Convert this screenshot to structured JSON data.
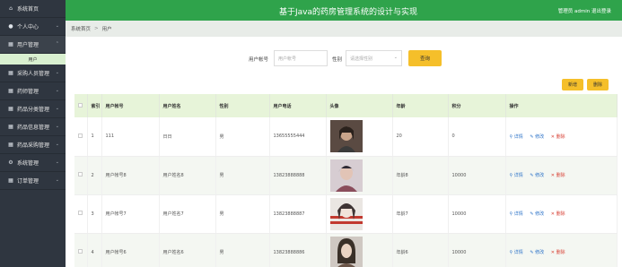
{
  "header": {
    "title": "基于Java的药房管理系统的设计与实现",
    "user_info": "管理员 admin",
    "logout": "退出登录"
  },
  "sidebar": {
    "items": [
      {
        "label": "系统首页",
        "icon": "home-icon"
      },
      {
        "label": "个人中心",
        "icon": "user-icon"
      },
      {
        "label": "用户管理",
        "icon": "grid-icon"
      },
      {
        "label": "采购人员管理",
        "icon": "grid-icon"
      },
      {
        "label": "药师管理",
        "icon": "grid-icon"
      },
      {
        "label": "药品分类管理",
        "icon": "grid-icon"
      },
      {
        "label": "药品信息管理",
        "icon": "grid-icon"
      },
      {
        "label": "药品采购管理",
        "icon": "grid-icon"
      },
      {
        "label": "系统管理",
        "icon": "gear-icon"
      },
      {
        "label": "订单管理",
        "icon": "grid-icon"
      }
    ],
    "sub_item": "用户"
  },
  "breadcrumb": {
    "home": "系统首页",
    "separator": ">",
    "current": "用户"
  },
  "search": {
    "account_label": "用户帐号",
    "account_placeholder": "用户帐号",
    "gender_label": "性别",
    "gender_placeholder": "请选择性别",
    "button": "查询"
  },
  "actions": {
    "add": "新增",
    "delete": "删除"
  },
  "table": {
    "headers": [
      "",
      "索引",
      "用户帐号",
      "用户姓名",
      "性别",
      "用户电话",
      "头像",
      "年龄",
      "积分",
      "操作"
    ],
    "rows": [
      {
        "index": "1",
        "account": "111",
        "name": "日日",
        "gender": "男",
        "phone": "13655555444",
        "age": "20",
        "points": "0",
        "photo_colors": [
          "#5a4a42",
          "#c9a48a",
          "#3b3b3b"
        ]
      },
      {
        "index": "2",
        "account": "用户帐号8",
        "name": "用户姓名8",
        "gender": "男",
        "phone": "13823888888",
        "age": "年龄8",
        "points": "10000",
        "photo_colors": [
          "#2e2a34",
          "#e2c4b6",
          "#8a4d5c"
        ]
      },
      {
        "index": "3",
        "account": "用户帐号7",
        "name": "用户姓名7",
        "gender": "男",
        "phone": "13823888887",
        "age": "年龄7",
        "points": "10000",
        "photo_colors": [
          "#c2392f",
          "#f1e3da",
          "#3e3434"
        ]
      },
      {
        "index": "4",
        "account": "用户帐号6",
        "name": "用户姓名6",
        "gender": "男",
        "phone": "13823888886",
        "age": "年龄6",
        "points": "10000",
        "photo_colors": [
          "#3a3028",
          "#e9d3c2",
          "#6b5548"
        ]
      }
    ],
    "ops": {
      "view": "详情",
      "edit": "修改",
      "del": "删除"
    }
  },
  "colors": {
    "header": "#2fa34b",
    "sidebar": "#2f3640",
    "button": "#f5bf2a",
    "table_header": "#e7f4d9"
  }
}
